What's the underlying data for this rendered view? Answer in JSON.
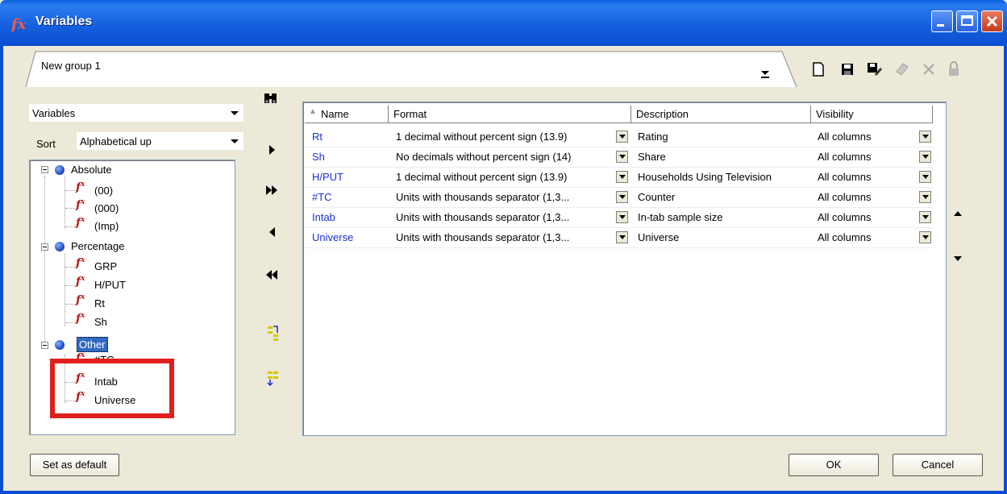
{
  "window": {
    "title": "Variables"
  },
  "group_selector": {
    "value": "New group 1"
  },
  "toolbar": {
    "icons": [
      "new-icon",
      "save-icon",
      "save-as-icon",
      "edit-icon",
      "delete-icon",
      "lock-icon"
    ]
  },
  "left": {
    "category_combo": "Variables",
    "sort_label": "Sort",
    "sort_combo": "Alphabetical up",
    "tree": [
      {
        "label": "Absolute",
        "children": [
          "(00)",
          "(000)",
          "(Imp)"
        ]
      },
      {
        "label": "Percentage",
        "children": [
          "GRP",
          "H/PUT",
          "Rt",
          "Sh"
        ]
      },
      {
        "label": "Other",
        "children": [
          "#TC",
          "Intab",
          "Universe"
        ]
      }
    ]
  },
  "grid": {
    "columns": [
      "Name",
      "Format",
      "Description",
      "Visibility"
    ],
    "rows": [
      {
        "name": "Rt",
        "format": "1 decimal without percent sign (13.9)",
        "description": "Rating",
        "visibility": "All columns"
      },
      {
        "name": "Sh",
        "format": "No decimals without percent sign (14)",
        "description": "Share",
        "visibility": "All columns"
      },
      {
        "name": "H/PUT",
        "format": "1 decimal without percent sign (13.9)",
        "description": "Households Using Television",
        "visibility": "All columns"
      },
      {
        "name": "#TC",
        "format": "Units with thousands separator (1,3...",
        "description": "Counter",
        "visibility": "All columns"
      },
      {
        "name": "Intab",
        "format": "Units with thousands separator (1,3...",
        "description": "In-tab sample size",
        "visibility": "All columns"
      },
      {
        "name": "Universe",
        "format": "Units with thousands separator (1,3...",
        "description": "Universe",
        "visibility": "All columns"
      }
    ]
  },
  "buttons": {
    "set_default": "Set as default",
    "ok": "OK",
    "cancel": "Cancel"
  },
  "colors": {
    "title_bar": "#0B4DCF",
    "highlight": "#E0201C",
    "name_text": "#1C2ED8",
    "fx_icon": "#B01C1C"
  }
}
